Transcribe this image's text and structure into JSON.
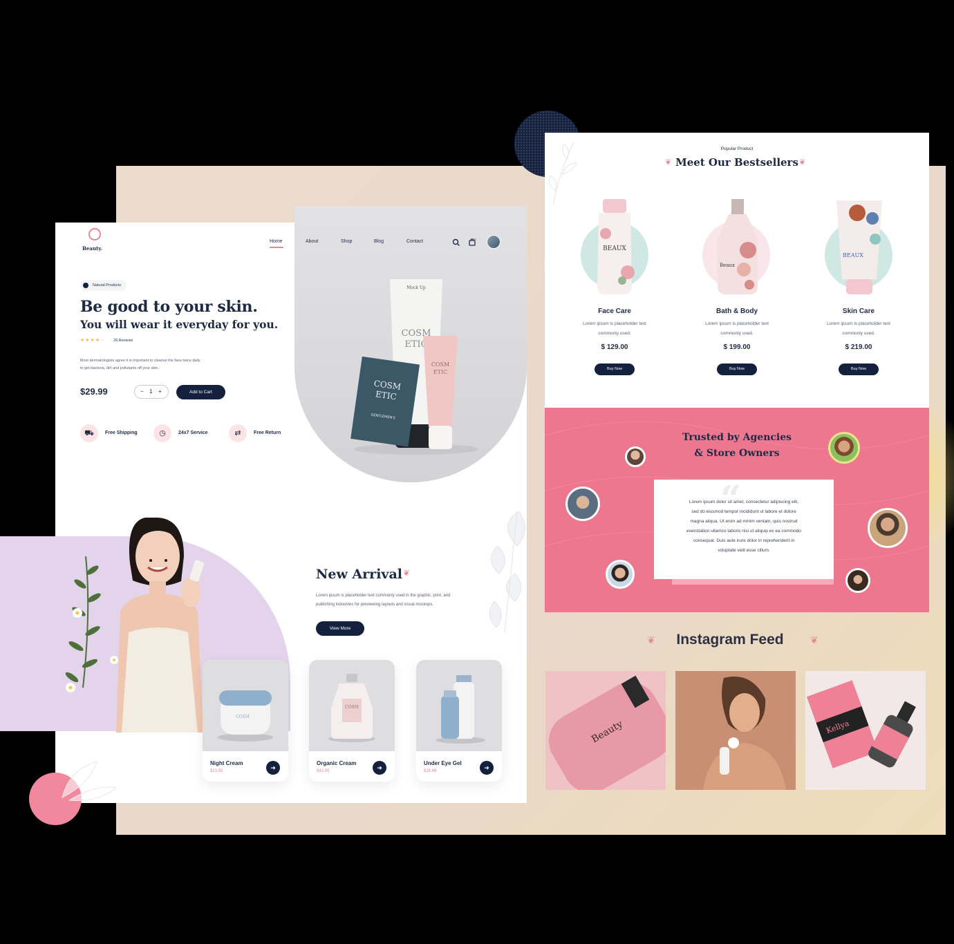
{
  "brand": {
    "name": "Beauty."
  },
  "nav": {
    "links": [
      "Home",
      "About",
      "Shop",
      "Blog",
      "Contact"
    ]
  },
  "hero": {
    "badge": "Natural Products",
    "title_line1": "Be good to your skin.",
    "title_line2": "You will wear it everyday for you.",
    "rating": 4,
    "reviews": "29 Reviews",
    "description_line1": "Most dermatologists agree it is important to cleanse the face twice daily",
    "description_line2": "to get bacteria, dirt and pollutants off your skin.",
    "price": "$29.99",
    "quantity": "1",
    "add_to_cart": "Add to Cart"
  },
  "features": [
    "Free Shipping",
    "24x7 Service",
    "Free Return"
  ],
  "hero_product": {
    "tube_brand": "Mock Up",
    "tube_label_1": "COSM",
    "tube_label_2": "ETIC",
    "card_label_1": "COSM",
    "card_label_2": "ETIC",
    "card_sub": "GENTLEMEN'S"
  },
  "new_arrival": {
    "title": "New Arrival",
    "desc_line1": "Lorem ipsum is placeholder text commonly used in the graphic, print, and",
    "desc_line2": "publishing industries for previewing layouts and visual mockups.",
    "button": "View More"
  },
  "products": [
    {
      "name": "Night Cream",
      "price": "$23.99"
    },
    {
      "name": "Organic Cream",
      "price": "$43.99"
    },
    {
      "name": "Under Eye Gel",
      "price": "$28.99"
    }
  ],
  "bestsellers": {
    "eyebrow": "Popular Product",
    "title": "Meet Our Bestsellers",
    "items": [
      {
        "name": "Face Care",
        "desc1": "Lorem ipsum is placeholder text",
        "desc2": "commonly used.",
        "price": "$ 129.00",
        "cta": "Buy Now",
        "label": "BEAUX"
      },
      {
        "name": "Bath & Body",
        "desc1": "Lorem ipsum is placeholder text",
        "desc2": "commonly used.",
        "price": "$ 199.00",
        "cta": "Buy Now",
        "label": "Beaux"
      },
      {
        "name": "Skin Care",
        "desc1": "Lorem ipsum is placeholder text",
        "desc2": "commonly used.",
        "price": "$ 219.00",
        "cta": "Buy Now",
        "label": "BEAUX"
      }
    ]
  },
  "testimonials": {
    "title_line1": "Trusted by Agencies",
    "title_line2": "& Store Owners",
    "quote_lines": [
      "Lorem ipsum dolor sit amet, consectetur adipiscing elit,",
      "sed do eiusmod tempor incididunt ut labore et dolore",
      "magna aliqua. Ut enim ad minim veniam, quis nostrud",
      "exercitation ullamco laboris nisi ut aliquip ex ea commodo",
      "consequat. Duis aute irure dolor in reprehenderit in",
      "voluptate velit esse cillum."
    ]
  },
  "instagram": {
    "title": "Instagram Feed",
    "post1_text": "Beauty",
    "post3_brand": "Kellya"
  },
  "colors": {
    "navy": "#13213f",
    "pink": "#ee7790",
    "accent": "#e38a9a",
    "lilac": "#e3d4ec"
  }
}
